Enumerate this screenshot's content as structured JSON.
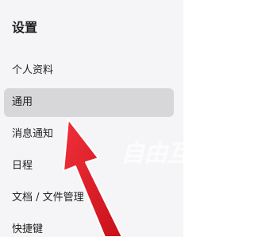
{
  "settings": {
    "title": "设置",
    "menu": [
      {
        "label": "个人资料",
        "active": false
      },
      {
        "label": "通用",
        "active": true
      },
      {
        "label": "消息通知",
        "active": false
      },
      {
        "label": "日程",
        "active": false
      },
      {
        "label": "文档 / 文件管理",
        "active": false
      },
      {
        "label": "快捷键",
        "active": false
      }
    ]
  },
  "watermark": {
    "text": "自由互联"
  },
  "colors": {
    "panel_background": "#f5f5f7",
    "active_item_background": "#d7d7da",
    "text": "#1f1f1f",
    "annotation_arrow": "#e8202a"
  }
}
